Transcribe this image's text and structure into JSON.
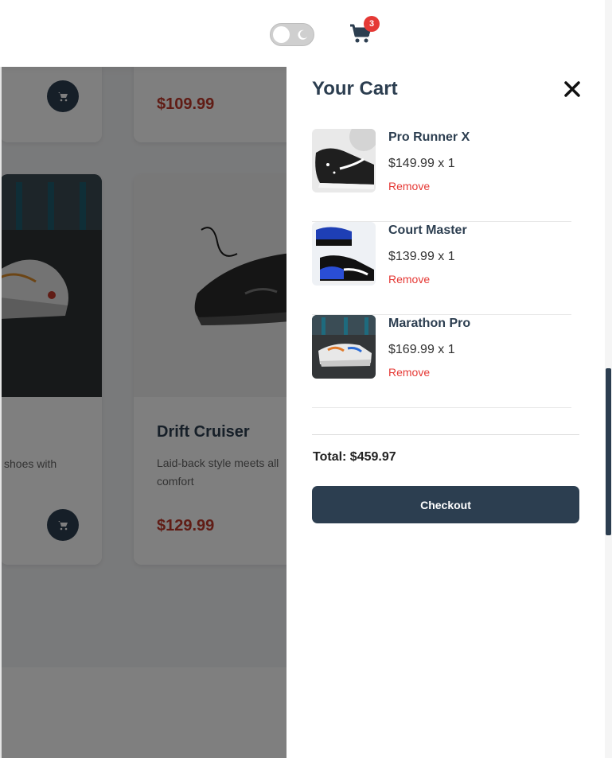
{
  "header": {
    "cart_count": "3",
    "icons": [
      "moon-icon",
      "cart-icon"
    ]
  },
  "background_products": [
    {
      "price": "$109.99"
    },
    {
      "name": "",
      "description": "shoes with",
      "price": ""
    },
    {
      "name": "Drift Cruiser",
      "description": "Laid-back style meets all comfort",
      "price": "$129.99"
    }
  ],
  "cart": {
    "title": "Your Cart",
    "items": [
      {
        "name": "Pro Runner X",
        "price_qty": "$149.99 x 1",
        "remove_label": "Remove"
      },
      {
        "name": "Court Master",
        "price_qty": "$139.99 x 1",
        "remove_label": "Remove"
      },
      {
        "name": "Marathon Pro",
        "price_qty": "$169.99 x 1",
        "remove_label": "Remove"
      }
    ],
    "total": "Total: $459.97",
    "checkout_label": "Checkout"
  },
  "colors": {
    "primary": "#2c3e50",
    "accent_red": "#c0392b",
    "remove_red": "#e53935",
    "badge_red": "#e53935"
  }
}
